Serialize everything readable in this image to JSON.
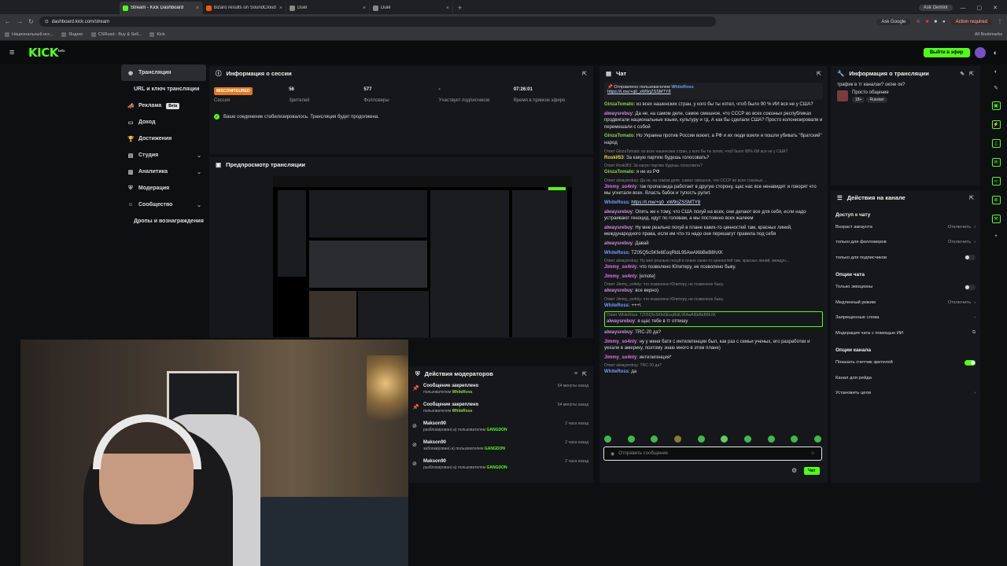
{
  "browser": {
    "tabs": [
      {
        "title": "Stream - Kick Dashboard",
        "active": true,
        "color": "#53fc18"
      },
      {
        "title": "bizaro results on SoundCloud",
        "active": false,
        "color": "#ff5500"
      },
      {
        "title": "Duel",
        "active": false,
        "color": "#888888"
      },
      {
        "title": "Duel",
        "active": false,
        "color": "#888888"
      }
    ],
    "new_tab": "+",
    "ask_gemini": "Ask Gemini",
    "url": "dashboard.kick.com/stream",
    "ask_google": "Ask Google",
    "action_required": "Action required",
    "bookmarks": [
      "Национальный исс...",
      "Яндекс",
      "CSRoad - Buy & Sell...",
      "Kick"
    ],
    "all_bookmarks": "All Bookmarks"
  },
  "header": {
    "logo": "KICK",
    "logo_sup": "beta",
    "go_live": "Выйти в эфир"
  },
  "sidebar": {
    "items": [
      {
        "label": "Трансляция",
        "icon": "broadcast-icon",
        "active": true
      },
      {
        "label": "URL и ключ трансляции",
        "sub": true
      },
      {
        "label": "Реклама",
        "icon": "megaphone-icon",
        "badge": "Beta"
      },
      {
        "label": "Доход",
        "icon": "wallet-icon"
      },
      {
        "label": "Достижения",
        "icon": "trophy-icon"
      },
      {
        "label": "Студия",
        "icon": "studio-icon",
        "chevron": true
      },
      {
        "label": "Аналитика",
        "icon": "chart-icon",
        "chevron": true
      },
      {
        "label": "Модерация",
        "icon": "shield-icon"
      },
      {
        "label": "Сообщество",
        "icon": "people-icon",
        "chevron": true
      },
      {
        "label": "Дропы и вознаграждения",
        "sub": true
      }
    ]
  },
  "session": {
    "title": "Информация о сессии",
    "status_badge": "MISCONFIGURED",
    "stats": [
      {
        "label": "Сессия"
      },
      {
        "value": "56",
        "label": "Зрителей"
      },
      {
        "value": "577",
        "label": "Фолловеры"
      },
      {
        "value": "-",
        "label": "Участвует подписчиков"
      },
      {
        "value": "07:26:01",
        "label": "Время в прямом эфире"
      }
    ],
    "notice": "Ваше соединение стабилизировалось. Трансляция будет продолжена."
  },
  "preview": {
    "title": "Предпросмотр трансляции"
  },
  "mod_actions": {
    "title": "Действия модераторов",
    "rows": [
      {
        "icon": "pin-icon",
        "title": "Сообщение закреплено",
        "by_prefix": "пользователем ",
        "by": "WhiteRoss",
        "time": "54 минуты назад"
      },
      {
        "icon": "pin-icon",
        "title": "Сообщение закреплено",
        "by_prefix": "пользователем ",
        "by": "WhiteRoss",
        "time": "54 минуты назад"
      },
      {
        "icon": "ban-icon",
        "title": "Makson90",
        "by_prefix": "разблокирован(-а) пользователем ",
        "by": "GANGDON",
        "time": "2 часа назад"
      },
      {
        "icon": "ban-icon",
        "title": "Makson90",
        "by_prefix": "заблокирован(-а) пользователем ",
        "by": "GANGDON",
        "time": "2 часа назад"
      },
      {
        "icon": "ban-icon",
        "title": "Makson90",
        "by_prefix": "разблокирован(-а) пользователем ",
        "by": "GANGDON",
        "time": "2 часа назад"
      }
    ]
  },
  "chat": {
    "title": "Чат",
    "pinned_head": "Отправлено пользователем",
    "pinned_user": "WhiteRoss",
    "pinned_link": "https://t.me/+q0_xW9rjZSSMTY8",
    "messages": [
      {
        "user": "GinzaTomato",
        "cls": "u-g",
        "text": "из всех нашенских стран, у кого бы ты хотел, чтоб было 90 % ИИ вся не у США?"
      },
      {
        "user": "alwaysrebuy",
        "cls": "u-a",
        "text": "Да не, на самом деле, самое смешное, что СССР во всех союзных республиках продвигали национальные языки, культуру и тд. А как бы сделали США? Просто колонизировали и перемешали с собой"
      },
      {
        "user": "GinzaTomato",
        "cls": "u-g",
        "text": "Но Украина против России воюет, а РФ и их люди взяли и пошли убивать \"братский\" народ"
      },
      {
        "reply": "Ответ GinzaTomato: из всех нашенских стран, у кого бы ты хотел, чтоб было 90% ИИ вся не у США?",
        "user": "Roskil53",
        "cls": "u-r",
        "text": "За какую партию будешь голосовать?"
      },
      {
        "reply": "Ответ Roskil53: За какую партию будешь голосовать?",
        "user": "GinzaTomato",
        "cls": "u-g",
        "text": "я не из РФ"
      },
      {
        "reply": "Ответ alwaysrebuy: Да не, на самом деле, самое смешное, что СССР во всех союзных ...",
        "user": "Jimmy_so4nly",
        "cls": "u-j",
        "text": "так пропаганда работает в другую сторону, щас нас все ненавидят и говорят что мы угнетали всех. Власть бабок и тупость рулит."
      },
      {
        "user": "WhiteRoss",
        "cls": "u-w",
        "link": "https://t.me/+q0_xW9rjZSSMTY8"
      },
      {
        "user": "alwaysrebuy",
        "cls": "u-a",
        "text": "Опять же к тому, что США похуй на всех, они делают все для себя, если надо устраивают геноцид, идут по головам, а мы постоянно всех жалеем"
      },
      {
        "user": "alwaysrebuy",
        "cls": "u-a",
        "text": "Ну мне реально похуй в плане каких-то ценностей там, красных линий, международного права, если им что-то надо они перешагут правила под себя"
      },
      {
        "user": "alwaysrebuy",
        "cls": "u-a",
        "text": "Давай"
      },
      {
        "user": "WhiteRoss",
        "cls": "u-w",
        "text": "TZ05Q5c5Kfe6EoqRldL95AwAl6bBeB8hXK"
      },
      {
        "reply": "Ответ alwaysrebuy: Ну мне реально похуй в плане каких-то ценностей там, красных линий, междун...",
        "user": "Jimmy_so4nly",
        "cls": "u-j",
        "text": "что позволено Юпитеру, не позволено быку."
      },
      {
        "user": "Jimmy_so4nly",
        "cls": "u-j",
        "text": "[emote]"
      },
      {
        "reply": "Ответ Jimmy_so4nly: что позволено Юпитеру, не позволено быку.",
        "user": "alwaysrebuy",
        "cls": "u-a",
        "text": "все верно)"
      },
      {
        "reply": "Ответ Jimmy_so4nly: что позволено Юпитеру, не позволено быку.",
        "user": "WhiteRoss",
        "cls": "u-w",
        "text": "+++\\"
      },
      {
        "reply": "Ответ WhiteRoss: TZ05Q5c5Kfe6EoqRldL95AwAl6bBeB8hXK",
        "user": "alwaysrebuy",
        "cls": "u-a",
        "text": "я щас тебе в тг отпишу",
        "highlight": true
      },
      {
        "user": "alwaysrebuy",
        "cls": "u-a",
        "text": "TRC-20 да?"
      },
      {
        "user": "Jimmy_so4nly",
        "cls": "u-j",
        "text": "ну у меня батя с интилигенции был, как раз с семьи ученых, его разработки и уехали в америку, поэтому знаю много в этом плане)"
      },
      {
        "user": "Jimmy_so4nly",
        "cls": "u-j",
        "text": "интилигенция*"
      },
      {
        "reply": "Ответ alwaysrebuy: TRC-20 да?",
        "user": "WhiteRoss",
        "cls": "u-w",
        "text": "да"
      }
    ],
    "input_placeholder": "Отправить сообщение",
    "send": "Чат"
  },
  "stream_info": {
    "title": "Информация о трансляции",
    "stream_title": "трафик в тг каналах? ок/не ок?",
    "category": "Просто общение",
    "tags": [
      "18+",
      "Russian"
    ]
  },
  "channel_actions": {
    "title": "Действия на канале",
    "sections": [
      {
        "heading": "Доступ к чату",
        "options": [
          {
            "label": "Возраст аккаунта",
            "value": "Отключить",
            "kind": "arrow"
          },
          {
            "label": "только для фолловеров",
            "value": "Отключить",
            "kind": "arrow"
          },
          {
            "label": "только для подписчиков",
            "kind": "toggle",
            "on": false
          }
        ]
      },
      {
        "heading": "Опции чата",
        "options": [
          {
            "label": "Только эмоционы",
            "kind": "toggle",
            "on": false
          },
          {
            "label": "Медленный режим",
            "value": "Отключить",
            "kind": "arrow"
          },
          {
            "label": "Запрещенные слова",
            "kind": "arrow"
          },
          {
            "label": "Модерация чата с помощью ИИ",
            "kind": "ext"
          }
        ]
      },
      {
        "heading": "Опции канала",
        "options": [
          {
            "label": "Показать счетчик зрителей",
            "kind": "toggle",
            "on": true
          },
          {
            "label": "Канал для рейда",
            "kind": "none"
          },
          {
            "label": "Установить цели",
            "kind": "arrow"
          }
        ]
      }
    ]
  }
}
